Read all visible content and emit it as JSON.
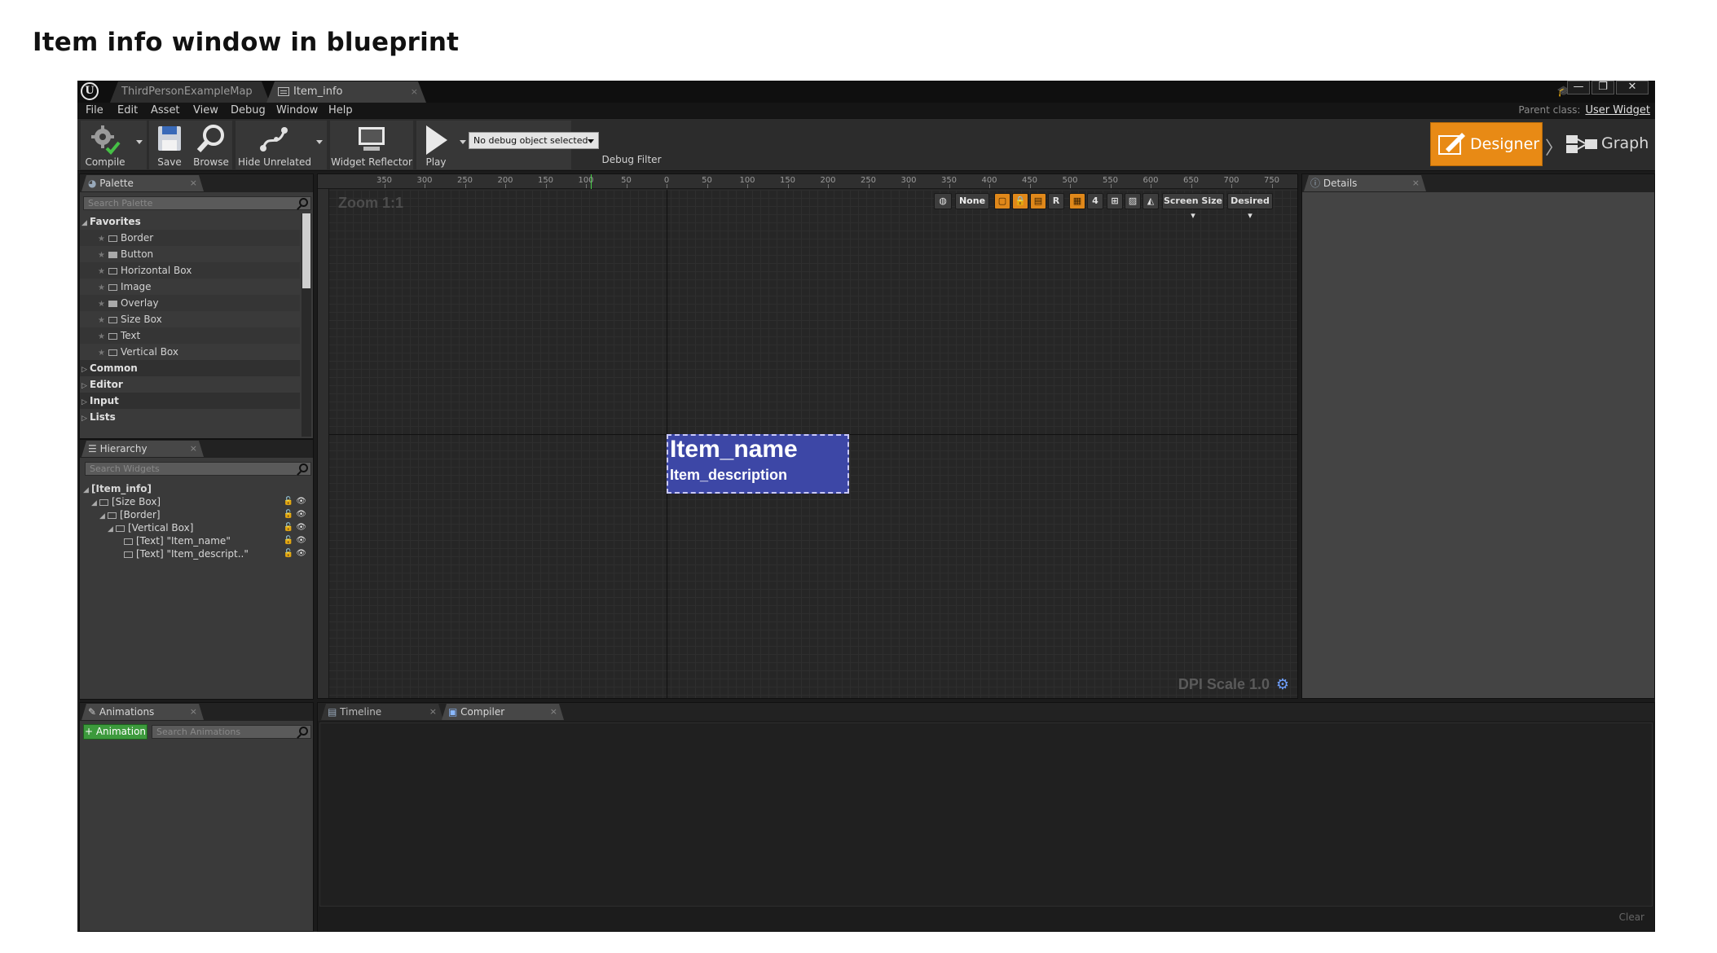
{
  "caption": "Item info window in blueprint",
  "titlebar": {
    "logo": "U",
    "tabs": [
      {
        "label": "ThirdPersonExampleMap"
      },
      {
        "label": "Item_info"
      }
    ],
    "close_glyph": "×",
    "window_buttons": {
      "minimize": "—",
      "restore": "❐",
      "close": "✕"
    }
  },
  "menubar": {
    "items": [
      "File",
      "Edit",
      "Asset",
      "View",
      "Debug",
      "Window",
      "Help"
    ],
    "parent_class_label": "Parent class:",
    "parent_class_value": "User Widget"
  },
  "toolbar": {
    "compile_label": "Compile",
    "save_label": "Save",
    "browse_label": "Browse",
    "hide_unrelated_label": "Hide Unrelated",
    "widget_reflector_label": "Widget Reflector",
    "play_label": "Play",
    "debug_select_value": "No debug object selected",
    "debug_filter_label": "Debug Filter",
    "designer_label": "Designer",
    "graph_label": "Graph"
  },
  "palette": {
    "tab_label": "Palette",
    "search_placeholder": "Search Palette",
    "favorites_label": "Favorites",
    "favorites": [
      "Border",
      "Button",
      "Horizontal Box",
      "Image",
      "Overlay",
      "Size Box",
      "Text",
      "Vertical Box"
    ],
    "categories": [
      "Common",
      "Editor",
      "Input",
      "Lists"
    ]
  },
  "hierarchy": {
    "tab_label": "Hierarchy",
    "search_placeholder": "Search Widgets",
    "rows": [
      "[Item_info]",
      "[Size Box]",
      "[Border]",
      "[Vertical Box]",
      "[Text] \"Item_name\"",
      "[Text] \"Item_descript..\""
    ]
  },
  "designer": {
    "zoom_label": "Zoom 1:1",
    "dpi_label": "DPI Scale 1.0",
    "ruler_labels": [
      "350",
      "300",
      "250",
      "200",
      "150",
      "100",
      "50",
      "0",
      "50",
      "100",
      "150",
      "200",
      "250",
      "300",
      "350",
      "400",
      "450",
      "500",
      "550",
      "600",
      "650",
      "700",
      "750"
    ],
    "vp_toolbar": {
      "none_label": "None",
      "r_label": "R",
      "grid_value": "4",
      "screen_size_label": "Screen Size",
      "desired_label": "Desired"
    },
    "widget": {
      "item_name": "Item_name",
      "item_description": "Item_description",
      "background_color": "#3d47a6"
    }
  },
  "details": {
    "tab_label": "Details"
  },
  "animations": {
    "tab_label": "Animations",
    "add_button_label": "+ Animation",
    "search_placeholder": "Search Animations"
  },
  "bottom_tabs": {
    "timeline_label": "Timeline",
    "compiler_results_label": "Compiler Results",
    "clear_label": "Clear"
  },
  "colors": {
    "accent_orange": "#e88a15",
    "widget_blue": "#3d47a6",
    "add_green": "#3c9a3c"
  }
}
